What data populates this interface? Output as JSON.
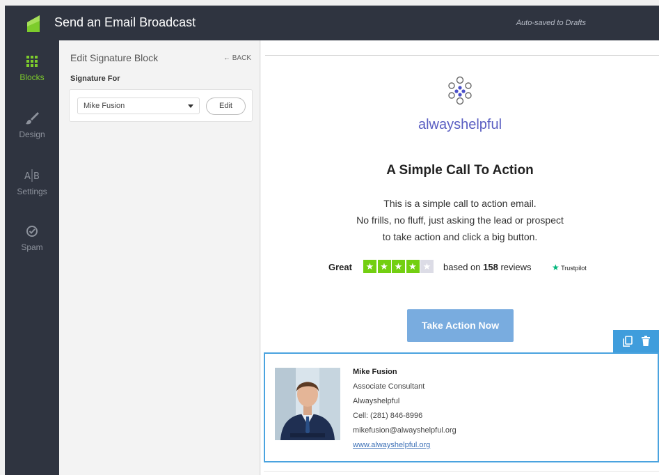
{
  "header": {
    "title": "Send an Email Broadcast",
    "autosave_status": "Auto-saved to Drafts"
  },
  "nav": {
    "items": [
      {
        "label": "Blocks",
        "icon": "grid-icon",
        "active": true
      },
      {
        "label": "Design",
        "icon": "brush-icon",
        "active": false
      },
      {
        "label": "Settings",
        "icon": "ab-icon",
        "active": false
      },
      {
        "label": "Spam",
        "icon": "check-circle-icon",
        "active": false
      }
    ]
  },
  "panel": {
    "title": "Edit Signature Block",
    "back_label": "← BACK",
    "signature_for_label": "Signature For",
    "selected_signature": "Mike Fusion",
    "edit_label": "Edit"
  },
  "email": {
    "brand_name": "alwayshelpful",
    "headline": "A Simple Call To Action",
    "body_lines": [
      "This is a simple call to action email.",
      "No frills, no fluff, just asking the lead or prospect",
      "to take action and click a big button."
    ],
    "rating": {
      "label": "Great",
      "stars_filled": 4,
      "stars_total": 5,
      "prefix": "based on",
      "count": "158",
      "suffix": "reviews",
      "provider": "Trustpilot"
    },
    "cta_label": "Take Action Now",
    "signature": {
      "name": "Mike Fusion",
      "title": "Associate Consultant",
      "company": "Alwayshelpful",
      "phone": "Cell: (281) 846-8996",
      "email": "mikefusion@alwayshelpful.org",
      "website": "www.alwayshelpful.org"
    }
  },
  "colors": {
    "chrome": "#2f3440",
    "accent_green": "#7dcc2c",
    "brand_purple": "#5a5ec2",
    "cta_blue": "#79acdf",
    "selection_blue": "#4aa3df",
    "trustpilot_green": "#73cf11"
  }
}
